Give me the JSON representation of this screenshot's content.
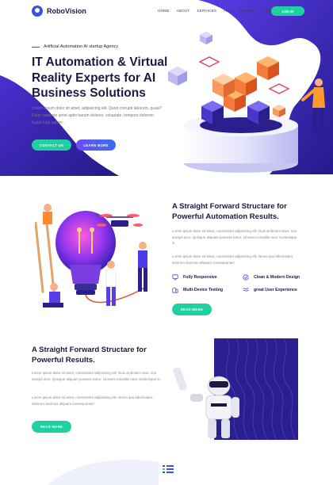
{
  "brand": {
    "name": "RoboVision",
    "accent": "#3b4fe0",
    "green": "#1fd1a0",
    "navy": "#2b1f8f"
  },
  "nav": {
    "items": [
      "HOME",
      "ABOUT",
      "SERVICES",
      "FAQ",
      "PRICING",
      "CONTACT"
    ],
    "login_label": "LOG IN"
  },
  "hero": {
    "eyebrow": "Artificial Automation AI startup Agency",
    "title": "IT Automation & Virtual Reality Experts for AI Business Solutions",
    "description": "Lorem ipsum dolor sit amet, adipisicing elit. Quod corrupti laborum, quasi? Dolor sapiente amet aptio harum dolores, voluptate, tempora dolorem fugiat fuga autem .",
    "contact_label": "CONTACT US",
    "learn_label": "LEARN MORE"
  },
  "section2": {
    "title": "A Straight Forward Structare for Powerful Automation Results.",
    "para1": "Lorem ipsum dolor sit amet, consectetur adipisicing elit. Duis at dictum risus, non suscpit arcu. Quisque aliquam posuere tortor, sit amet convallis nunc scelerisque in.",
    "para2": "Lorem ipsum dolor sit amet, consectetur adipisicing elit. Nemo quo laboriosam, dolorum ducimus aliquam consequuntur!",
    "features": [
      "Fully Responsive",
      "Clean & Modern Design",
      "Multi-Device Testing",
      "great User Experience"
    ],
    "button_label": "READ MORE"
  },
  "section3": {
    "title": "A Straight Forward Structare for Powerful Results.",
    "para1": "Lorem ipsum dolor sit amet, consectetur adipisicing elit. Duis at dictum risus, non suscpit arcu. Quisque aliquam posuere tortor, sit amet convallis nunc scelerisque in.",
    "para2": "Lorem ipsum dolor sit amet, consectetur adipisicing elit. Nemo quo laboriosam, dolorum ducimus aliquam consequuntur!",
    "button_label": "READ MORE"
  }
}
